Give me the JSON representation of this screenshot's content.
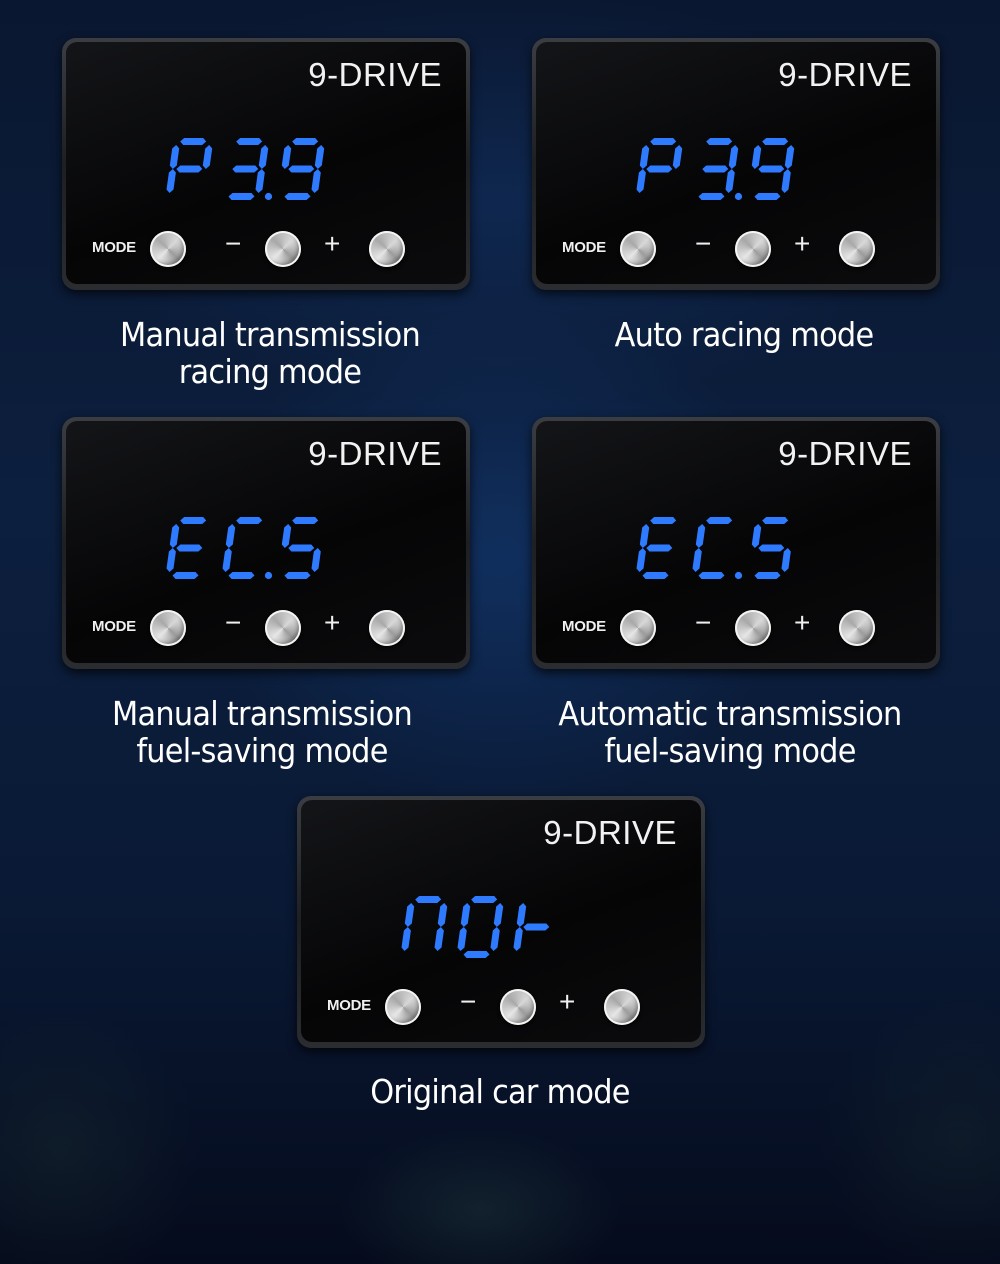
{
  "brand": "9-DRIVE",
  "controls": {
    "mode_label": "MODE",
    "minus_label": "−",
    "plus_label": "+"
  },
  "colors": {
    "display_blue": "#2f7bff",
    "background": "#0c1f3e",
    "screen": "#050506"
  },
  "modes": [
    {
      "display": "P3.9",
      "caption_line1": "Manual transmission",
      "caption_line2": "racing mode"
    },
    {
      "display": "P3.9",
      "caption_line1": "Auto racing mode",
      "caption_line2": ""
    },
    {
      "display": "EC.5",
      "caption_line1": "Manual transmission",
      "caption_line2": "fuel-saving mode"
    },
    {
      "display": "EC.5",
      "caption_line1": "Automatic transmission",
      "caption_line2": "fuel-saving mode"
    },
    {
      "display": "nor",
      "caption_line1": "Original car mode",
      "caption_line2": ""
    }
  ]
}
